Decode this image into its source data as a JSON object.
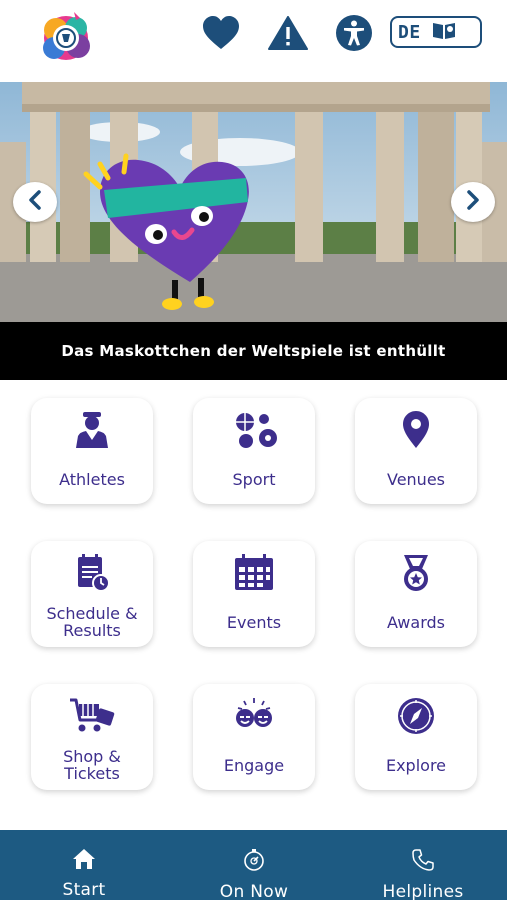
{
  "header": {
    "language": "DE",
    "icons": [
      "heart-icon",
      "warning-icon",
      "accessibility-icon",
      "book-icon"
    ]
  },
  "banner": {
    "caption": "Das Maskottchen der Weltspiele ist enthüllt",
    "arrows": [
      "chevron-left-icon",
      "chevron-right-icon"
    ]
  },
  "tiles": [
    {
      "label": "Athletes",
      "icon": "athlete-icon"
    },
    {
      "label": "Sport",
      "icon": "sport-balls-icon"
    },
    {
      "label": "Venues",
      "icon": "location-pin-icon"
    },
    {
      "label": "Schedule & Results",
      "icon": "schedule-icon"
    },
    {
      "label": "Events",
      "icon": "calendar-icon"
    },
    {
      "label": "Awards",
      "icon": "medal-icon"
    },
    {
      "label": "Shop & Tickets",
      "icon": "shopping-cart-icon"
    },
    {
      "label": "Engage",
      "icon": "engage-icon"
    },
    {
      "label": "Explore",
      "icon": "compass-icon"
    }
  ],
  "bottom_nav": [
    {
      "label": "Start",
      "icon": "home-icon"
    },
    {
      "label": "On Now",
      "icon": "stopwatch-icon"
    },
    {
      "label": "Helplines",
      "icon": "phone-icon"
    }
  ],
  "colors": {
    "accent": "#1d4e7a",
    "tile_text": "#3d2e8c",
    "nav_bg": "#1d5a82"
  }
}
